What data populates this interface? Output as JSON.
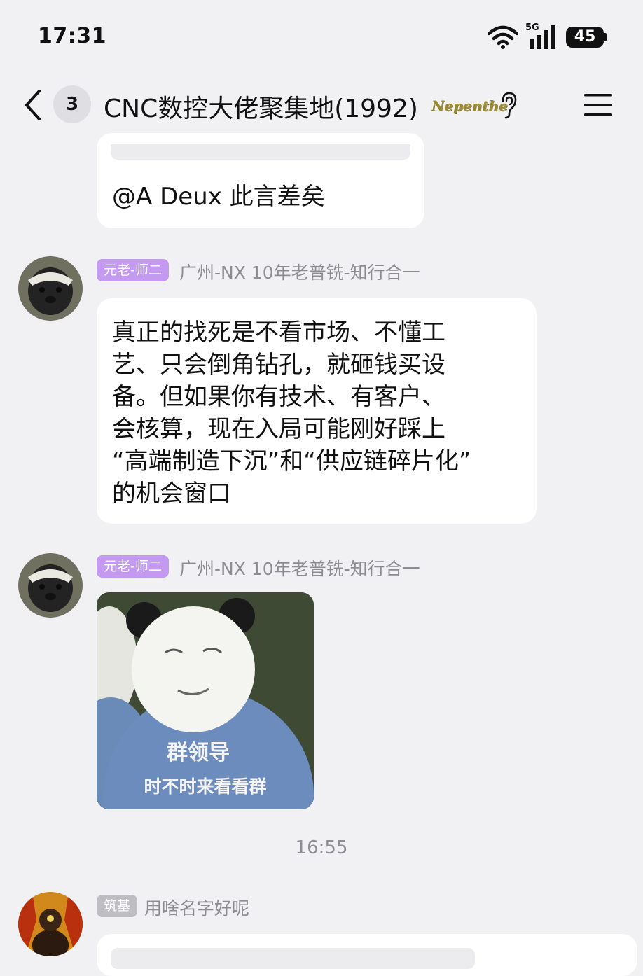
{
  "status_bar": {
    "time": "17:31",
    "network": "5G",
    "battery": "45"
  },
  "header": {
    "unread_count": "3",
    "title": "CNC数控大佬聚集地(1992)",
    "badge_text": "Nepenthe"
  },
  "messages": [
    {
      "text": "@A Deux 此言差矣"
    },
    {
      "tag": "元老-师二",
      "sender": "广州-NX 10年老普铣-知行合一",
      "text_lines": [
        "真正的找死是不看市场、不懂工",
        "艺、只会倒角钻孔，就砸钱买设",
        "备。但如果你有技术、有客户、",
        "会核算，现在入局可能刚好踩上",
        "“高端制造下沉”和“供应链碎片化”",
        "的机会窗口"
      ]
    },
    {
      "tag": "元老-师二",
      "sender": "广州-NX 10年老普铣-知行合一",
      "sticker_line1": "群领导",
      "sticker_line2": "时不时来看看群"
    },
    {
      "tag": "筑基",
      "sender": "用啥名字好呢"
    }
  ],
  "timestamp": "16:55",
  "colors": {
    "background": "#f1f1f4",
    "bubble": "#ffffff",
    "tag_purple": "#c39af0",
    "tag_gray": "#bdbdc2",
    "meta_text": "#8d8d93"
  }
}
